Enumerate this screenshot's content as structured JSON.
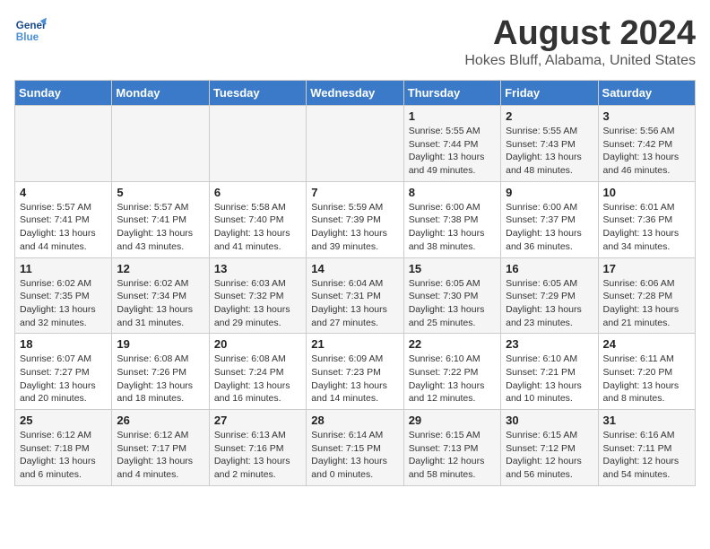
{
  "header": {
    "logo": {
      "line1": "General",
      "line2": "Blue"
    },
    "title": "August 2024",
    "location": "Hokes Bluff, Alabama, United States"
  },
  "columns": [
    "Sunday",
    "Monday",
    "Tuesday",
    "Wednesday",
    "Thursday",
    "Friday",
    "Saturday"
  ],
  "rows": [
    [
      {
        "day": "",
        "info": ""
      },
      {
        "day": "",
        "info": ""
      },
      {
        "day": "",
        "info": ""
      },
      {
        "day": "",
        "info": ""
      },
      {
        "day": "1",
        "info": "Sunrise: 5:55 AM\nSunset: 7:44 PM\nDaylight: 13 hours\nand 49 minutes."
      },
      {
        "day": "2",
        "info": "Sunrise: 5:55 AM\nSunset: 7:43 PM\nDaylight: 13 hours\nand 48 minutes."
      },
      {
        "day": "3",
        "info": "Sunrise: 5:56 AM\nSunset: 7:42 PM\nDaylight: 13 hours\nand 46 minutes."
      }
    ],
    [
      {
        "day": "4",
        "info": "Sunrise: 5:57 AM\nSunset: 7:41 PM\nDaylight: 13 hours\nand 44 minutes."
      },
      {
        "day": "5",
        "info": "Sunrise: 5:57 AM\nSunset: 7:41 PM\nDaylight: 13 hours\nand 43 minutes."
      },
      {
        "day": "6",
        "info": "Sunrise: 5:58 AM\nSunset: 7:40 PM\nDaylight: 13 hours\nand 41 minutes."
      },
      {
        "day": "7",
        "info": "Sunrise: 5:59 AM\nSunset: 7:39 PM\nDaylight: 13 hours\nand 39 minutes."
      },
      {
        "day": "8",
        "info": "Sunrise: 6:00 AM\nSunset: 7:38 PM\nDaylight: 13 hours\nand 38 minutes."
      },
      {
        "day": "9",
        "info": "Sunrise: 6:00 AM\nSunset: 7:37 PM\nDaylight: 13 hours\nand 36 minutes."
      },
      {
        "day": "10",
        "info": "Sunrise: 6:01 AM\nSunset: 7:36 PM\nDaylight: 13 hours\nand 34 minutes."
      }
    ],
    [
      {
        "day": "11",
        "info": "Sunrise: 6:02 AM\nSunset: 7:35 PM\nDaylight: 13 hours\nand 32 minutes."
      },
      {
        "day": "12",
        "info": "Sunrise: 6:02 AM\nSunset: 7:34 PM\nDaylight: 13 hours\nand 31 minutes."
      },
      {
        "day": "13",
        "info": "Sunrise: 6:03 AM\nSunset: 7:32 PM\nDaylight: 13 hours\nand 29 minutes."
      },
      {
        "day": "14",
        "info": "Sunrise: 6:04 AM\nSunset: 7:31 PM\nDaylight: 13 hours\nand 27 minutes."
      },
      {
        "day": "15",
        "info": "Sunrise: 6:05 AM\nSunset: 7:30 PM\nDaylight: 13 hours\nand 25 minutes."
      },
      {
        "day": "16",
        "info": "Sunrise: 6:05 AM\nSunset: 7:29 PM\nDaylight: 13 hours\nand 23 minutes."
      },
      {
        "day": "17",
        "info": "Sunrise: 6:06 AM\nSunset: 7:28 PM\nDaylight: 13 hours\nand 21 minutes."
      }
    ],
    [
      {
        "day": "18",
        "info": "Sunrise: 6:07 AM\nSunset: 7:27 PM\nDaylight: 13 hours\nand 20 minutes."
      },
      {
        "day": "19",
        "info": "Sunrise: 6:08 AM\nSunset: 7:26 PM\nDaylight: 13 hours\nand 18 minutes."
      },
      {
        "day": "20",
        "info": "Sunrise: 6:08 AM\nSunset: 7:24 PM\nDaylight: 13 hours\nand 16 minutes."
      },
      {
        "day": "21",
        "info": "Sunrise: 6:09 AM\nSunset: 7:23 PM\nDaylight: 13 hours\nand 14 minutes."
      },
      {
        "day": "22",
        "info": "Sunrise: 6:10 AM\nSunset: 7:22 PM\nDaylight: 13 hours\nand 12 minutes."
      },
      {
        "day": "23",
        "info": "Sunrise: 6:10 AM\nSunset: 7:21 PM\nDaylight: 13 hours\nand 10 minutes."
      },
      {
        "day": "24",
        "info": "Sunrise: 6:11 AM\nSunset: 7:20 PM\nDaylight: 13 hours\nand 8 minutes."
      }
    ],
    [
      {
        "day": "25",
        "info": "Sunrise: 6:12 AM\nSunset: 7:18 PM\nDaylight: 13 hours\nand 6 minutes."
      },
      {
        "day": "26",
        "info": "Sunrise: 6:12 AM\nSunset: 7:17 PM\nDaylight: 13 hours\nand 4 minutes."
      },
      {
        "day": "27",
        "info": "Sunrise: 6:13 AM\nSunset: 7:16 PM\nDaylight: 13 hours\nand 2 minutes."
      },
      {
        "day": "28",
        "info": "Sunrise: 6:14 AM\nSunset: 7:15 PM\nDaylight: 13 hours\nand 0 minutes."
      },
      {
        "day": "29",
        "info": "Sunrise: 6:15 AM\nSunset: 7:13 PM\nDaylight: 12 hours\nand 58 minutes."
      },
      {
        "day": "30",
        "info": "Sunrise: 6:15 AM\nSunset: 7:12 PM\nDaylight: 12 hours\nand 56 minutes."
      },
      {
        "day": "31",
        "info": "Sunrise: 6:16 AM\nSunset: 7:11 PM\nDaylight: 12 hours\nand 54 minutes."
      }
    ]
  ]
}
